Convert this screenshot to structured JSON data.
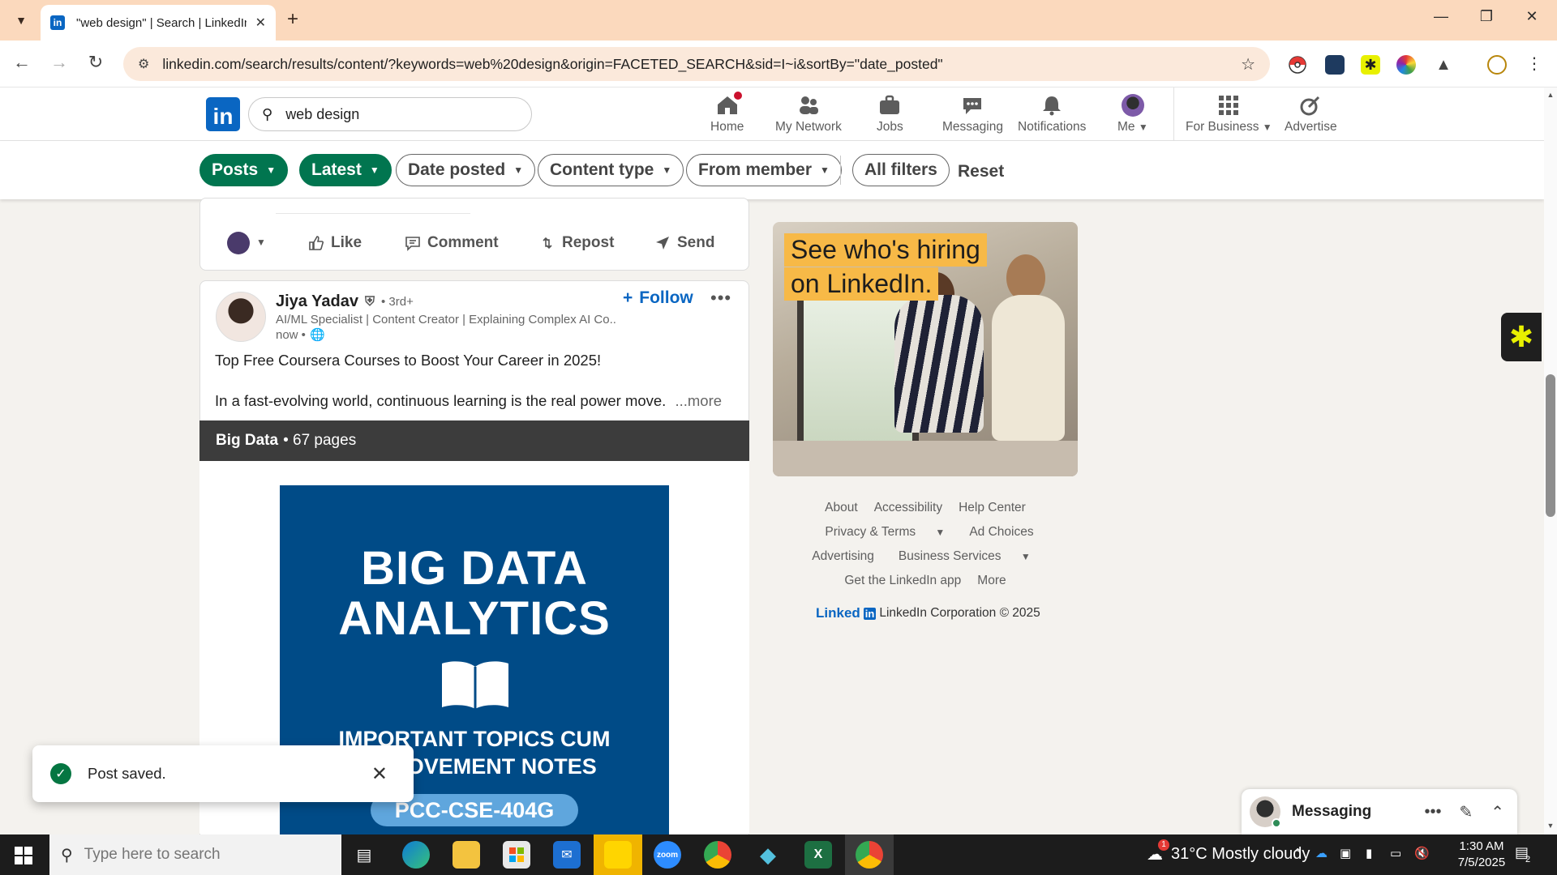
{
  "browser": {
    "tab_title": "\"web design\" | Search | LinkedIn",
    "url": "linkedin.com/search/results/content/?keywords=web%20design&origin=FACETED_SEARCH&sid=I~i&sortBy=\"date_posted\""
  },
  "linkedin": {
    "search_value": "web design",
    "nav": {
      "home": "Home",
      "network": "My Network",
      "jobs": "Jobs",
      "messaging": "Messaging",
      "notifications": "Notifications",
      "me": "Me",
      "business": "For Business",
      "advertise": "Advertise"
    },
    "filters": {
      "posts": "Posts",
      "latest": "Latest",
      "date_posted": "Date posted",
      "content_type": "Content type",
      "from_member": "From member",
      "all_filters": "All filters",
      "reset": "Reset"
    },
    "actions": {
      "like": "Like",
      "comment": "Comment",
      "repost": "Repost",
      "send": "Send"
    },
    "post": {
      "author": "Jiya Yadav",
      "degree": "• 3rd+",
      "headline": "AI/ML Specialist | Content Creator | Explaining Complex AI Co...",
      "time": "now •",
      "follow": "Follow",
      "line1": "Top Free Coursera Courses to Boost Your Career in 2025!",
      "line2": "In a fast-evolving world, continuous learning is the real power move.",
      "see_more": "...more",
      "doc_title": "Big Data",
      "doc_pages": "• 67 pages",
      "doc_heading_1": "BIG DATA",
      "doc_heading_2": "ANALYTICS",
      "doc_sub_1": "IMPORTANT TOPICS CUM",
      "doc_sub_2": "IMPROVEMENT NOTES",
      "doc_code": "PCC-CSE-404G"
    },
    "ad": {
      "line1": "See who's hiring",
      "line2": "on LinkedIn."
    },
    "footer": {
      "about": "About",
      "accessibility": "Accessibility",
      "help": "Help Center",
      "privacy": "Privacy & Terms",
      "ad_choices": "Ad Choices",
      "advertising": "Advertising",
      "business_services": "Business Services",
      "get_app": "Get the LinkedIn app",
      "more": "More",
      "brand_linked": "Linked",
      "brand_in": "in",
      "copyright": "LinkedIn Corporation © 2025"
    },
    "toast": "Post saved.",
    "messaging": "Messaging"
  },
  "taskbar": {
    "search_placeholder": "Type here to search",
    "weather": "31°C  Mostly cloudy",
    "weather_badge": "1",
    "time": "1:30 AM",
    "date": "7/5/2025",
    "notifications_count": "2"
  },
  "colors": {
    "linkedin_blue": "#0a66c2",
    "filter_green": "#01754f",
    "tab_strip": "#fbd9bd"
  }
}
